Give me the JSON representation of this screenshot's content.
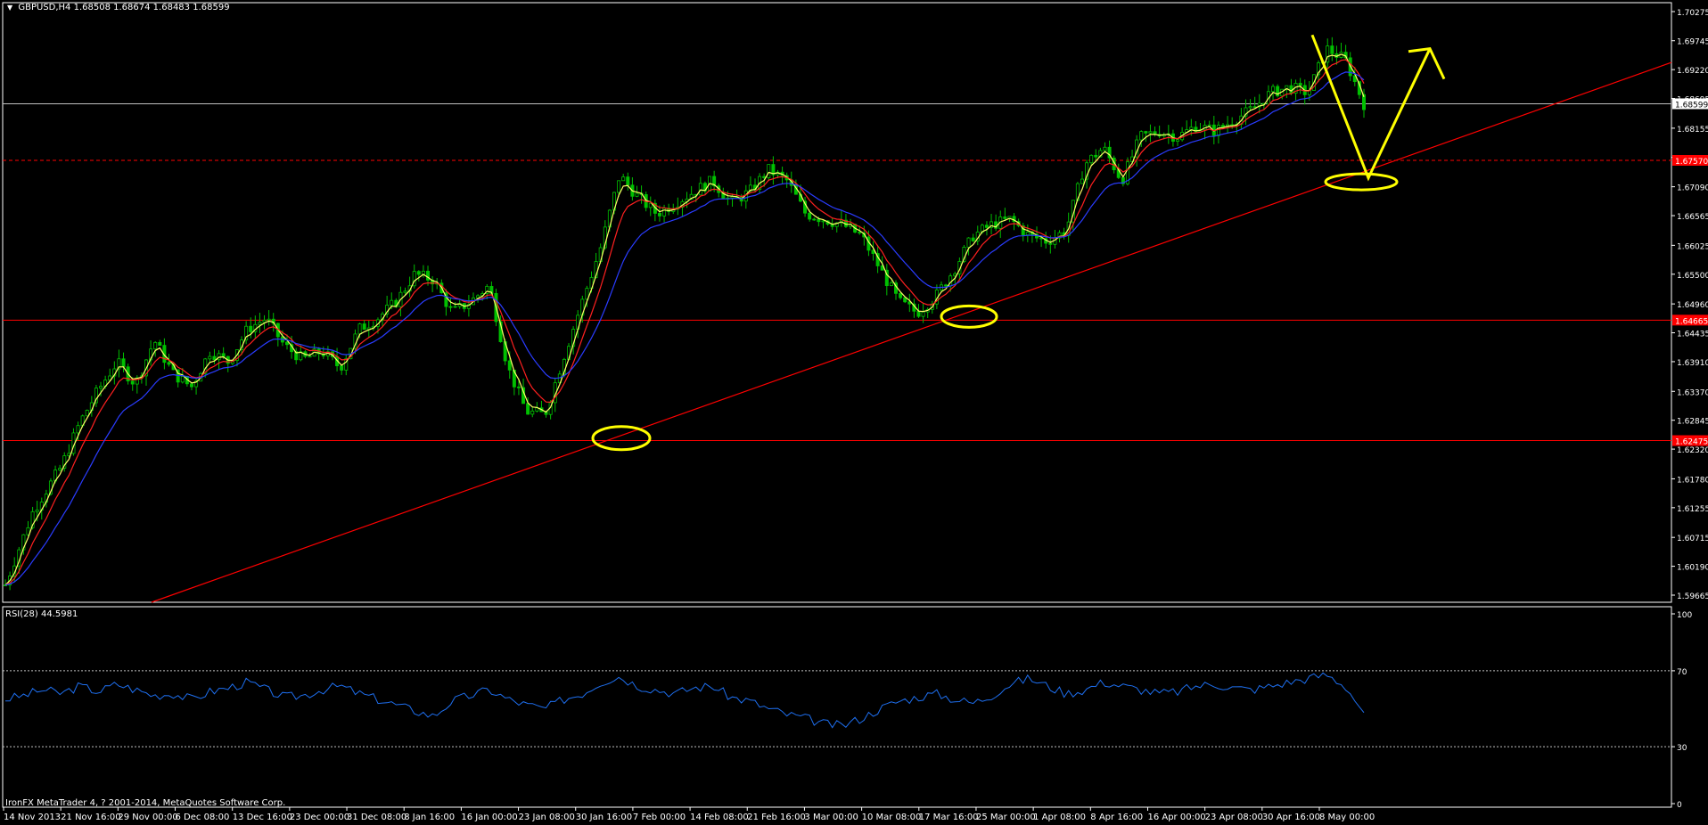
{
  "header": {
    "symbol": "GBPUSD,H4",
    "ohlc": "1.68508 1.68674 1.68483 1.68599"
  },
  "indicator": {
    "label": "RSI(28) 44.5981"
  },
  "footer": {
    "copyright": "IronFX MetaTrader 4, ? 2001-2014, MetaQuotes Software Corp."
  },
  "colors": {
    "background": "#000000",
    "candles": "#00c000",
    "ma_fast": "#ffff66",
    "ma_mid": "#ff2020",
    "ma_slow": "#2a3cff",
    "support_lines": "#ff0000",
    "annotations": "#ffff00",
    "rsi_line": "#1e6ff0",
    "axis_text": "#ffffff",
    "price_tag_current": "#ffffff",
    "price_tag_level": "#ff0000"
  },
  "chart_data": [
    {
      "type": "candlestick",
      "title": "GBPUSD,H4",
      "ylim": [
        1.59665,
        1.70275
      ],
      "y_ticks": [
        "1.70275",
        "1.69745",
        "1.69220",
        "1.68695",
        "1.68155",
        "1.67625",
        "1.67090",
        "1.66565",
        "1.66025",
        "1.65500",
        "1.64960",
        "1.64435",
        "1.63910",
        "1.63370",
        "1.62845",
        "1.62320",
        "1.61780",
        "1.61255",
        "1.60715",
        "1.60190",
        "1.59665"
      ],
      "x_ticks": [
        "14 Nov 2013",
        "21 Nov 16:00",
        "29 Nov 00:00",
        "6 Dec 08:00",
        "13 Dec 16:00",
        "23 Dec 00:00",
        "31 Dec 08:00",
        "8 Jan 16:00",
        "16 Jan 00:00",
        "23 Jan 08:00",
        "30 Jan 16:00",
        "7 Feb 00:00",
        "14 Feb 08:00",
        "21 Feb 16:00",
        "3 Mar 00:00",
        "10 Mar 08:00",
        "17 Mar 16:00",
        "25 Mar 00:00",
        "1 Apr 08:00",
        "8 Apr 16:00",
        "16 Apr 00:00",
        "23 Apr 08:00",
        "30 Apr 16:00",
        "8 May 00:00"
      ],
      "price_path": [
        [
          0,
          1.5985
        ],
        [
          1.5,
          1.612
        ],
        [
          3,
          1.62
        ],
        [
          4,
          1.628
        ],
        [
          5,
          1.634
        ],
        [
          6,
          1.639
        ],
        [
          7,
          1.635
        ],
        [
          8,
          1.643
        ],
        [
          9,
          1.637
        ],
        [
          10,
          1.6345
        ],
        [
          11,
          1.641
        ],
        [
          12,
          1.639
        ],
        [
          13,
          1.645
        ],
        [
          14,
          1.647
        ],
        [
          15,
          1.642
        ],
        [
          16,
          1.6395
        ],
        [
          17,
          1.641
        ],
        [
          18,
          1.638
        ],
        [
          19,
          1.645
        ],
        [
          20,
          1.647
        ],
        [
          21,
          1.65
        ],
        [
          22,
          1.655
        ],
        [
          23,
          1.654
        ],
        [
          24,
          1.648
        ],
        [
          25,
          1.65
        ],
        [
          26,
          1.653
        ],
        [
          27,
          1.638
        ],
        [
          28,
          1.63
        ],
        [
          29,
          1.6295
        ],
        [
          30,
          1.64
        ],
        [
          31,
          1.65
        ],
        [
          32,
          1.66
        ],
        [
          33,
          1.673
        ],
        [
          34,
          1.669
        ],
        [
          35,
          1.666
        ],
        [
          36,
          1.668
        ],
        [
          37,
          1.67
        ],
        [
          38,
          1.672
        ],
        [
          39,
          1.668
        ],
        [
          40,
          1.67
        ],
        [
          41,
          1.674
        ],
        [
          42,
          1.672
        ],
        [
          43,
          1.666
        ],
        [
          44,
          1.665
        ],
        [
          45,
          1.664
        ],
        [
          46,
          1.662
        ],
        [
          47,
          1.656
        ],
        [
          48,
          1.65
        ],
        [
          49,
          1.648
        ],
        [
          50,
          1.651
        ],
        [
          51,
          1.656
        ],
        [
          52,
          1.662
        ],
        [
          53,
          1.664
        ],
        [
          54,
          1.665
        ],
        [
          55,
          1.662
        ],
        [
          56,
          1.661
        ],
        [
          57,
          1.663
        ],
        [
          58,
          1.675
        ],
        [
          59,
          1.678
        ],
        [
          60,
          1.672
        ],
        [
          61,
          1.68
        ],
        [
          62,
          1.681
        ],
        [
          63,
          1.68
        ],
        [
          64,
          1.682
        ],
        [
          65,
          1.681
        ],
        [
          66,
          1.683
        ],
        [
          67,
          1.685
        ],
        [
          68,
          1.688
        ],
        [
          69,
          1.689
        ],
        [
          70,
          1.688
        ],
        [
          71,
          1.696
        ],
        [
          72,
          1.694
        ],
        [
          73,
          1.686
        ]
      ],
      "levels": [
        {
          "price": 1.68599,
          "label": "1.68599",
          "style": "current-price"
        },
        {
          "price": 1.6757,
          "label": "1.67570",
          "style": "dashed-red"
        },
        {
          "price": 1.64665,
          "label": "1.64665",
          "style": "solid-red"
        },
        {
          "price": 1.62475,
          "label": "1.62475",
          "style": "solid-red"
        }
      ]
    },
    {
      "type": "line",
      "title": "RSI(28) 44.5981",
      "ylim": [
        0,
        100
      ],
      "y_ticks": [
        "100",
        "70",
        "30",
        "0"
      ],
      "levels": [
        70,
        30
      ],
      "values": [
        55,
        57,
        60,
        58,
        62,
        59,
        63,
        60,
        57,
        58,
        55,
        59,
        61,
        64,
        60,
        56,
        57,
        60,
        62,
        58,
        55,
        52,
        49,
        46,
        54,
        57,
        60,
        55,
        52,
        50,
        55,
        58,
        64,
        67,
        62,
        60,
        58,
        61,
        62,
        56,
        54,
        50,
        47,
        45,
        42,
        41,
        45,
        50,
        54,
        56,
        58,
        55,
        53,
        57,
        63,
        66,
        62,
        58,
        60,
        64,
        62,
        60,
        58,
        59,
        62,
        63,
        61,
        60,
        62,
        64,
        66,
        68,
        62,
        48
      ]
    }
  ]
}
